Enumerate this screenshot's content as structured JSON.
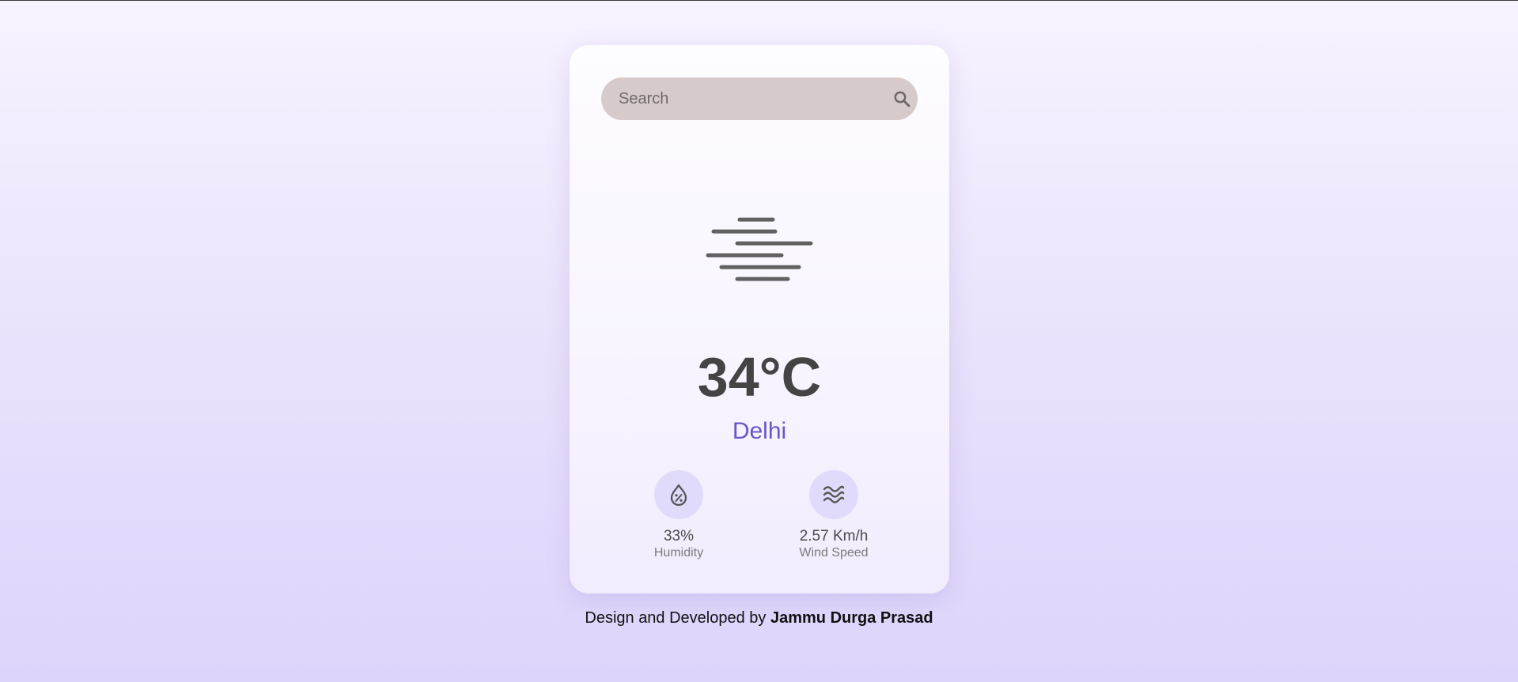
{
  "search": {
    "placeholder": "Search",
    "icon": "search-icon"
  },
  "weather": {
    "condition_icon": "mist-icon",
    "temperature": "34°C",
    "city": "Delhi",
    "humidity": {
      "icon": "humidity-icon",
      "value": "33%",
      "label": "Humidity"
    },
    "wind": {
      "icon": "wind-icon",
      "value": "2.57 Km/h",
      "label": "Wind Speed"
    }
  },
  "footer": {
    "prefix": "Design and Developed by ",
    "author": "Jammu Durga Prasad"
  },
  "colors": {
    "accent": "#6a56c8",
    "search_bg": "#d6cacb",
    "stat_icon_bg": "#e0dbfb"
  }
}
